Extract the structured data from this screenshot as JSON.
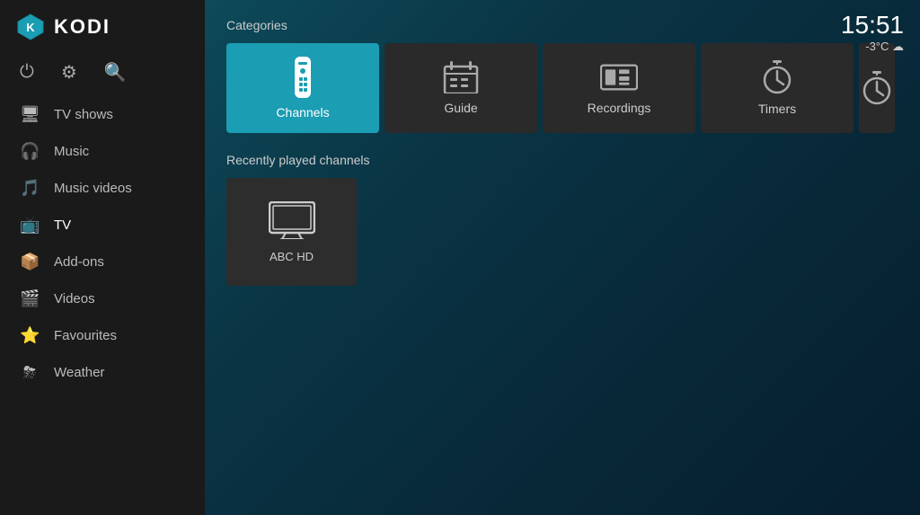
{
  "app": {
    "logo_text": "KODI"
  },
  "clock": {
    "time": "15:51",
    "meta": "-3°C ☁"
  },
  "sidebar": {
    "top_icons": [
      {
        "name": "power-icon",
        "symbol": "⏻"
      },
      {
        "name": "settings-icon",
        "symbol": "⚙"
      },
      {
        "name": "search-icon",
        "symbol": "🔍"
      }
    ],
    "nav_items": [
      {
        "id": "tv-shows",
        "label": "TV shows",
        "icon": "🖥"
      },
      {
        "id": "music",
        "label": "Music",
        "icon": "🎧"
      },
      {
        "id": "music-videos",
        "label": "Music videos",
        "icon": "🎵"
      },
      {
        "id": "tv",
        "label": "TV",
        "icon": "📺",
        "active": true
      },
      {
        "id": "add-ons",
        "label": "Add-ons",
        "icon": "📦"
      },
      {
        "id": "videos",
        "label": "Videos",
        "icon": "🎬"
      },
      {
        "id": "favourites",
        "label": "Favourites",
        "icon": "⭐"
      },
      {
        "id": "weather",
        "label": "Weather",
        "icon": "⛈"
      }
    ]
  },
  "main": {
    "categories_label": "Categories",
    "categories": [
      {
        "id": "channels",
        "label": "Channels",
        "active": true
      },
      {
        "id": "guide",
        "label": "Guide",
        "active": false
      },
      {
        "id": "recordings",
        "label": "Recordings",
        "active": false
      },
      {
        "id": "timers",
        "label": "Timers",
        "active": false
      },
      {
        "id": "timers2",
        "label": "Tim...",
        "active": false,
        "partial": true
      }
    ],
    "recently_played_label": "Recently played channels",
    "channels": [
      {
        "id": "abc-hd",
        "label": "ABC HD"
      }
    ]
  }
}
